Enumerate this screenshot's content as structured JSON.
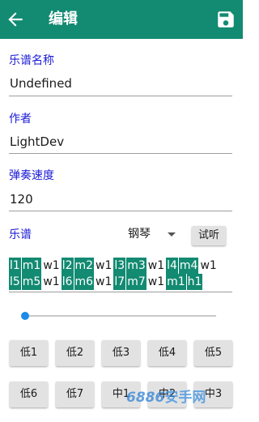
{
  "header": {
    "title": "编辑",
    "back_icon": "back-arrow-icon",
    "save_icon": "save-icon",
    "background_color": "#138a72"
  },
  "form": {
    "name_label": "乐谱名称",
    "name_value": "Undefined",
    "author_label": "作者",
    "author_value": "LightDev",
    "speed_label": "弹奏速度",
    "speed_value": "120",
    "score_label": "乐谱"
  },
  "instrument": {
    "selected": "钢琴",
    "dropdown_icon": "dropdown-arrow-icon"
  },
  "try_button": "试听",
  "score": {
    "rows": [
      [
        {
          "text": "l1",
          "hl": true
        },
        {
          "text": "m1",
          "hl": true
        },
        {
          "text": "w1",
          "hl": false
        },
        {
          "text": "l2",
          "hl": true
        },
        {
          "text": "m2",
          "hl": true
        },
        {
          "text": "w1",
          "hl": false
        },
        {
          "text": "l3",
          "hl": true
        },
        {
          "text": "m3",
          "hl": true
        },
        {
          "text": "w1",
          "hl": false
        },
        {
          "text": "l4",
          "hl": true
        },
        {
          "text": "m4",
          "hl": true
        },
        {
          "text": "w1",
          "hl": false
        }
      ],
      [
        {
          "text": "l5",
          "hl": true
        },
        {
          "text": "m5",
          "hl": true
        },
        {
          "text": "w1",
          "hl": false
        },
        {
          "text": "l6",
          "hl": true
        },
        {
          "text": "m6",
          "hl": true
        },
        {
          "text": "w1",
          "hl": false
        },
        {
          "text": "l7",
          "hl": true
        },
        {
          "text": "m7",
          "hl": true
        },
        {
          "text": "w1",
          "hl": false
        },
        {
          "text": "m1",
          "hl": true
        },
        {
          "text": "h1",
          "hl": true
        }
      ]
    ],
    "highlight_color": "#138a72"
  },
  "slider": {
    "value_fraction": 0.0,
    "thumb_color": "#1e8be8"
  },
  "note_buttons": {
    "row1": [
      "低1",
      "低2",
      "低3",
      "低4",
      "低5"
    ],
    "row2": [
      "低6",
      "低7",
      "中1",
      "中2",
      "中3"
    ]
  },
  "watermark": {
    "num": "6886",
    "text": "安手网"
  }
}
